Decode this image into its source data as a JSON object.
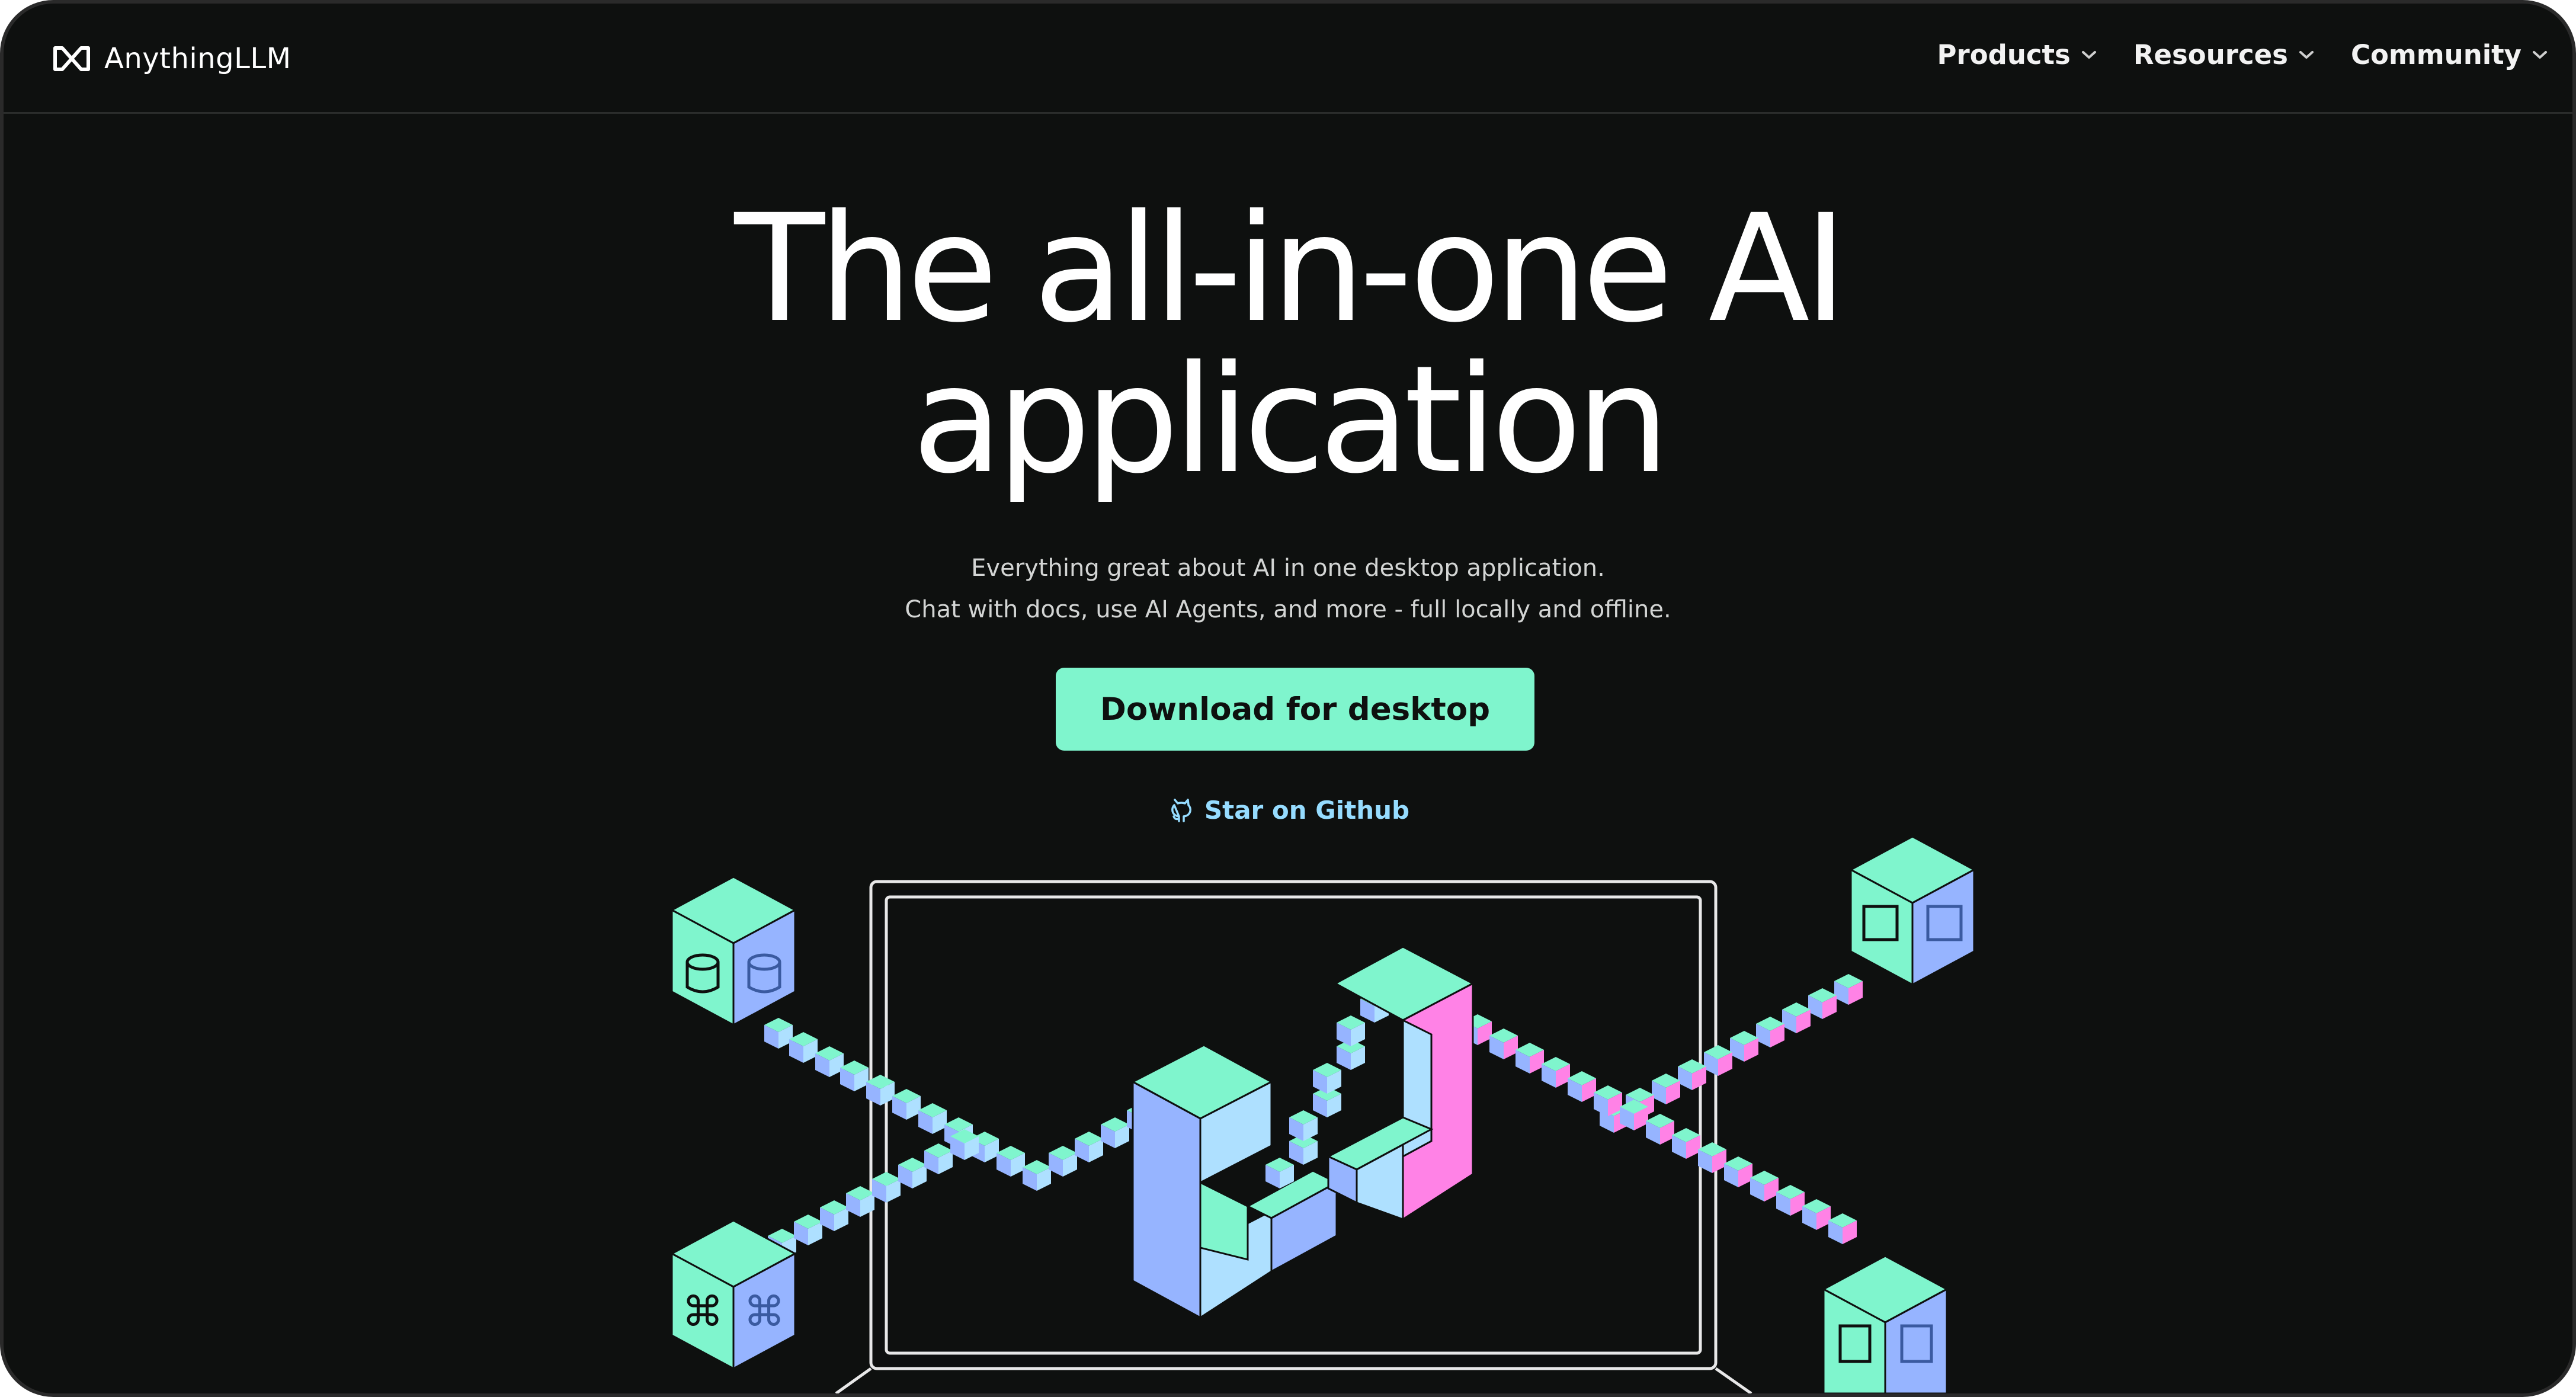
{
  "header": {
    "logo_text": "AnythingLLM",
    "nav": [
      {
        "label": "Products"
      },
      {
        "label": "Resources"
      },
      {
        "label": "Community"
      }
    ]
  },
  "hero": {
    "title_line1": "The all-in-one AI",
    "title_line2": "application",
    "subtitle_line1": "Everything great about AI in one desktop application.",
    "subtitle_line2": "Chat with docs, use AI Agents, and more - full locally and offline.",
    "cta_label": "Download for desktop",
    "github_label": "Star on Github"
  },
  "illustration": {
    "cube_icons": [
      "database-icon",
      "command-icon",
      "document-icon",
      "code-file-icon"
    ]
  },
  "colors": {
    "background": "#0e100f",
    "accent_mint": "#7ff5cd",
    "accent_blue": "#96b4ff",
    "accent_pink": "#ff82e6",
    "link_blue": "#96dcff"
  }
}
